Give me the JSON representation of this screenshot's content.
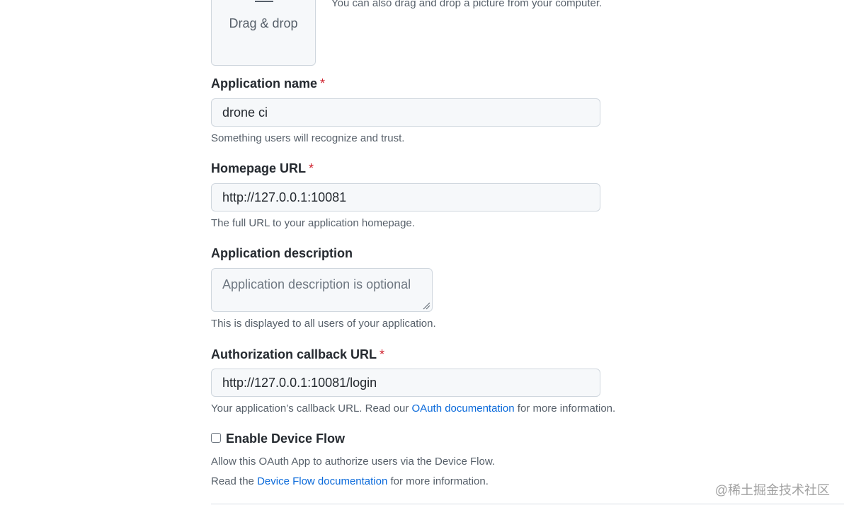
{
  "upload": {
    "drop_label": "Drag & drop",
    "drop_hint": "You can also drag and drop a picture from your computer."
  },
  "app_name": {
    "label": "Application name",
    "required_mark": "*",
    "value": "drone ci",
    "help": "Something users will recognize and trust."
  },
  "homepage": {
    "label": "Homepage URL",
    "required_mark": "*",
    "value": "http://127.0.0.1:10081",
    "help": "The full URL to your application homepage."
  },
  "description": {
    "label": "Application description",
    "placeholder": "Application description is optional",
    "help": "This is displayed to all users of your application."
  },
  "callback": {
    "label": "Authorization callback URL",
    "required_mark": "*",
    "value": "http://127.0.0.1:10081/login",
    "help_prefix": "Your application’s callback URL. Read our",
    "help_link": "OAuth documentation",
    "help_suffix": "for more information."
  },
  "device_flow": {
    "label": "Enable Device Flow",
    "checked": false,
    "note_line1": "Allow this OAuth App to authorize users via the Device Flow.",
    "note_line2_prefix": "Read the",
    "note_line2_link": "Device Flow documentation",
    "note_line2_suffix": "for more information."
  },
  "watermark": "@稀土掘金技术社区",
  "colors": {
    "required": "#cf222e",
    "link": "#0969da",
    "input_bg": "#f6f8fa",
    "border": "#d0d7de",
    "muted_text": "#57606a"
  }
}
